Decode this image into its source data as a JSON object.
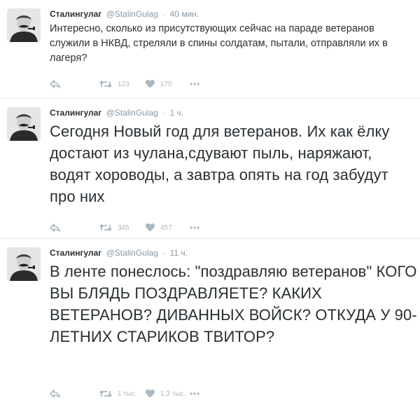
{
  "tweets": [
    {
      "name": "Сталингулаг",
      "handle": "@StalinGulag",
      "separator": "·",
      "time": "40 мин.",
      "text": "Интересно, сколько из присутствующих сейчас на параде ветеранов служили в НКВД, стреляли в спины солдатам, пытали, отправляли их в лагеря?",
      "retweets": "123",
      "likes": "170"
    },
    {
      "name": "Сталингулаг",
      "handle": "@StalinGulag",
      "separator": "·",
      "time": "1 ч.",
      "text": "Сегодня Новый год для ветеранов. Их как ёлку достают из чулана,сдувают пыль, наряжают, водят хороводы, а завтра опять на год забудут про них",
      "retweets": "345",
      "likes": "457"
    },
    {
      "name": "Сталингулаг",
      "handle": "@StalinGulag",
      "separator": "·",
      "time": "11 ч.",
      "text": "В ленте понеслось: \"поздравляю ветеранов\" КОГО ВЫ БЛЯДЬ ПОЗДРАВЛЯЕТЕ? КАКИХ ВЕТЕРАНОВ? ДИВАННЫХ ВОЙСК? ОТКУДА У 90-ЛЕТНИХ СТАРИКОВ ТВИТОР?",
      "retweets": "1 тыс.",
      "likes": "1,3 тыс."
    }
  ],
  "icons": {
    "reply": "reply-icon",
    "retweet": "retweet-icon",
    "like": "heart-icon",
    "more": "more-icon",
    "avatar": "stalin-avatar"
  },
  "colors": {
    "name": "#292f33",
    "meta": "#8899a6",
    "action": "#aab8c2",
    "divider": "#e1e8ed"
  }
}
